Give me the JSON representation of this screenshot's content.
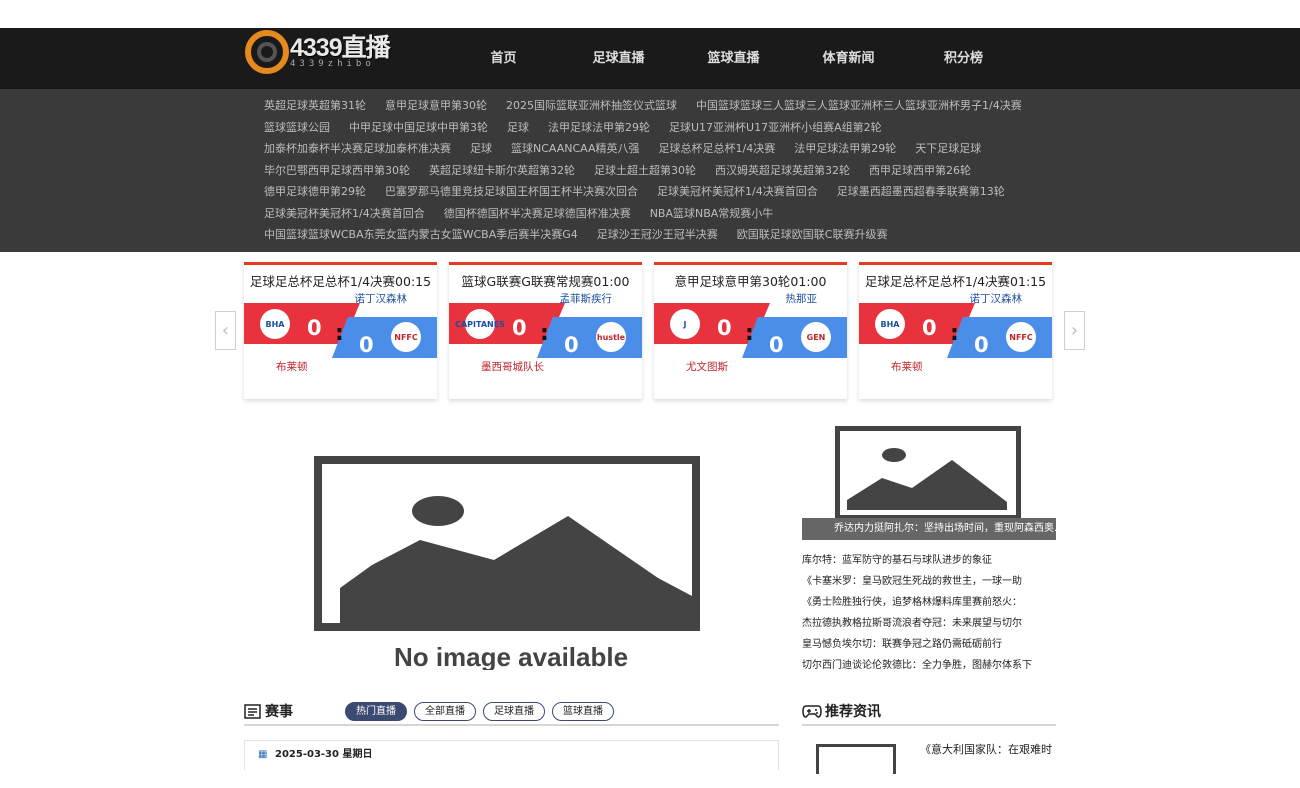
{
  "logo": {
    "text": "4339直播",
    "sub": "4339zhibo"
  },
  "nav": [
    "首页",
    "足球直播",
    "篮球直播",
    "体育新闻",
    "积分榜"
  ],
  "tags": [
    [
      "英超足球英超第31轮",
      "意甲足球意甲第30轮",
      "2025国际篮联亚洲杯抽签仪式篮球",
      "中国篮球篮球三人篮球三人篮球亚洲杯三人篮球亚洲杯男子1/4决赛"
    ],
    [
      "篮球篮球公园",
      "中甲足球中国足球中甲第3轮",
      "足球",
      "法甲足球法甲第29轮",
      "足球U17亚洲杯U17亚洲杯小组赛A组第2轮"
    ],
    [
      "加泰杯加泰杯半决赛足球加泰杯准决赛",
      "足球",
      "篮球NCAANCAA精英八强",
      "足球总杯足总杯1/4决赛",
      "法甲足球法甲第29轮",
      "天下足球足球"
    ],
    [
      "毕尔巴鄂西甲足球西甲第30轮",
      "英超足球纽卡斯尔英超第32轮",
      "足球土超土超第30轮",
      "西汉姆英超足球英超第32轮",
      "西甲足球西甲第26轮"
    ],
    [
      "德甲足球德甲第29轮",
      "巴塞罗那马德里竞技足球国王杯国王杯半决赛次回合",
      "足球美冠杯美冠杯1/4决赛首回合",
      "足球墨西超墨西超春季联赛第13轮"
    ],
    [
      "足球美冠杯美冠杯1/4决赛首回合",
      "德国杯德国杯半决赛足球德国杯准决赛",
      "NBA篮球NBA常规赛小牛"
    ],
    [
      "中国篮球篮球WCBA东莞女篮内蒙古女篮WCBA季后赛半决赛G4",
      "足球沙王冠沙王冠半决赛",
      "欧国联足球欧国联C联赛升级赛"
    ]
  ],
  "matches": [
    {
      "title": "足球足总杯足总杯1/4决赛00:15",
      "home": "布莱顿",
      "away": "诺丁汉森林",
      "home_score": "0",
      "away_score": "0",
      "home_badge": "BHA",
      "away_badge": "NFFC"
    },
    {
      "title": "篮球G联赛G联赛常规赛01:00",
      "home": "墨西哥城队长",
      "away": "孟菲斯疾行",
      "home_score": "0",
      "away_score": "0",
      "home_badge": "CAPITANES",
      "away_badge": "hustle"
    },
    {
      "title": "意甲足球意甲第30轮01:00",
      "home": "尤文图斯",
      "away": "热那亚",
      "home_score": "0",
      "away_score": "0",
      "home_badge": "J",
      "away_badge": "GEN"
    },
    {
      "title": "足球足总杯足总杯1/4决赛01:15",
      "home": "布莱顿",
      "away": "诺丁汉森林",
      "home_score": "0",
      "away_score": "0",
      "home_badge": "BHA",
      "away_badge": "NFFC"
    }
  ],
  "placeholder_text": "No image available",
  "side_caption": "乔达内力挺阿扎尔：坚持出场时间，重现阿森西奥...",
  "news": [
    "库尔特：蓝军防守的基石与球队进步的象征",
    "《卡塞米罗：皇马欧冠生死战的救世主，一球一助",
    "《勇士险胜独行侠，追梦格林爆料库里赛前怒火：",
    "杰拉德执教格拉斯哥流浪者夺冠：未来展望与切尔",
    "皇马憾负埃尔切：联赛争冠之路仍需砥砺前行",
    "切尔西门迪谈论伦敦德比：全力争胜，图赫尔体系下"
  ],
  "schedule": {
    "title": "赛事",
    "tabs": [
      "热门直播",
      "全部直播",
      "足球直播",
      "篮球直播"
    ],
    "date": "2025-03-30 星期日"
  },
  "recommend": {
    "title": "推荐资讯",
    "first": "《意大利国家队：在艰难时"
  },
  "colors": {
    "accent": "#e23b1f",
    "home": "#e8323e",
    "away": "#4b8eea",
    "header": "#1a1a1a",
    "tags_bg": "#3a3a3a"
  }
}
